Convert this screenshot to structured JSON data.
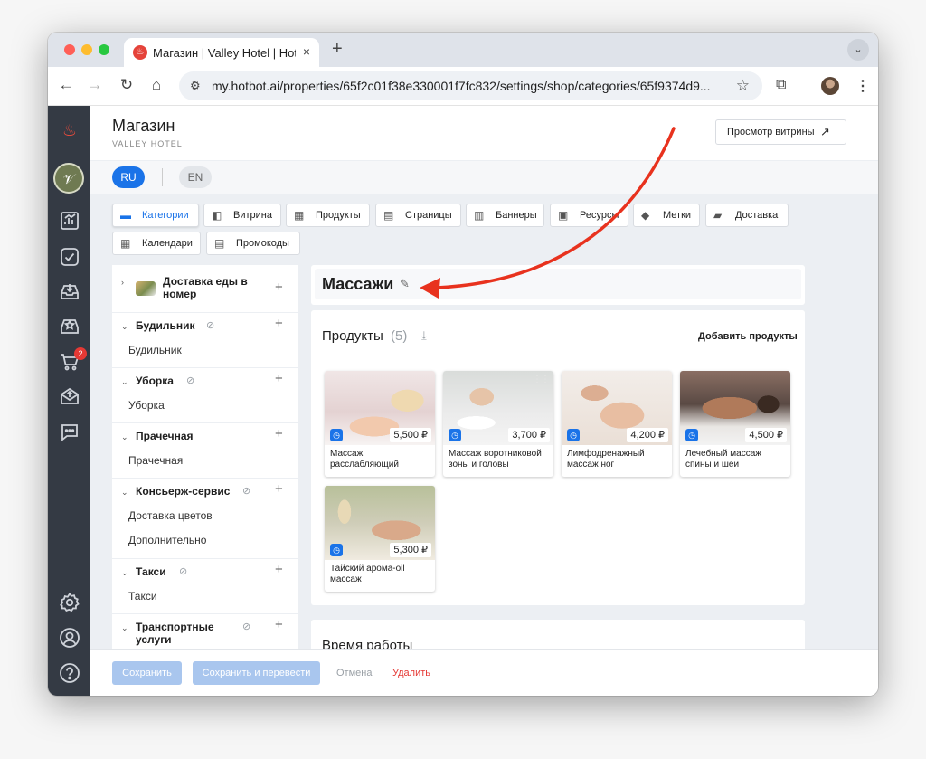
{
  "browser": {
    "tab_title": "Магазин | Valley Hotel | Hotbot",
    "tab_close": "×",
    "new_tab": "+",
    "dropdown": "⌄",
    "url": "my.hotbot.ai/properties/65f2c01f38e330001f7fc832/settings/shop/categories/65f9374d9..."
  },
  "header": {
    "title": "Магазин",
    "subtitle": "VALLEY HOTEL",
    "preview_label": "Просмотр витрины",
    "preview_icon": "↗"
  },
  "languages": {
    "ru": "RU",
    "en": "EN"
  },
  "tabs": [
    {
      "label": "Категории",
      "icon": "▬"
    },
    {
      "label": "Витрина",
      "icon": "◧"
    },
    {
      "label": "Продукты",
      "icon": "▦"
    },
    {
      "label": "Страницы",
      "icon": "▤"
    },
    {
      "label": "Баннеры",
      "icon": "▥"
    },
    {
      "label": "Ресурсы",
      "icon": "▣"
    },
    {
      "label": "Метки",
      "icon": "◆"
    },
    {
      "label": "Доставка",
      "icon": "▰"
    },
    {
      "label": "Календари",
      "icon": "▦"
    },
    {
      "label": "Промокоды",
      "icon": "▤"
    }
  ],
  "categories": [
    {
      "name": "Доставка еды в номер",
      "items": []
    },
    {
      "name": "Будильник",
      "items": [
        "Будильник"
      ]
    },
    {
      "name": "Уборка",
      "items": [
        "Уборка"
      ]
    },
    {
      "name": "Прачечная",
      "items": [
        "Прачечная"
      ]
    },
    {
      "name": "Консьерж-сервис",
      "items": [
        "Доставка цветов",
        "Дополнительно"
      ]
    },
    {
      "name": "Такси",
      "items": [
        "Такси"
      ]
    },
    {
      "name": "Транспортные услуги",
      "items": []
    }
  ],
  "category_title": "Массажи",
  "products_section": {
    "title": "Продукты",
    "count": "(5)",
    "add_label": "Добавить продукты"
  },
  "products": [
    {
      "name": "Массаж расслабляющий",
      "price": "5,500 ₽"
    },
    {
      "name": "Массаж воротниковой зоны и головы",
      "price": "3,700 ₽"
    },
    {
      "name": "Лимфодренажный массаж ног",
      "price": "4,200 ₽"
    },
    {
      "name": "Лечебный массаж спины и шеи",
      "price": "4,500 ₽"
    },
    {
      "name": "Тайский арома-oil массаж",
      "price": "5,300 ₽"
    }
  ],
  "hours_title": "Время работы",
  "sidebar": {
    "cart_badge": "2"
  },
  "footer": {
    "save": "Сохранить",
    "save_translate": "Сохранить и перевести",
    "cancel": "Отмена",
    "delete": "Удалить"
  },
  "colors": {
    "accent": "#1a73e8",
    "danger": "#e53935",
    "annotation_arrow": "#e8321e",
    "sidebar_bg": "#343a44"
  }
}
